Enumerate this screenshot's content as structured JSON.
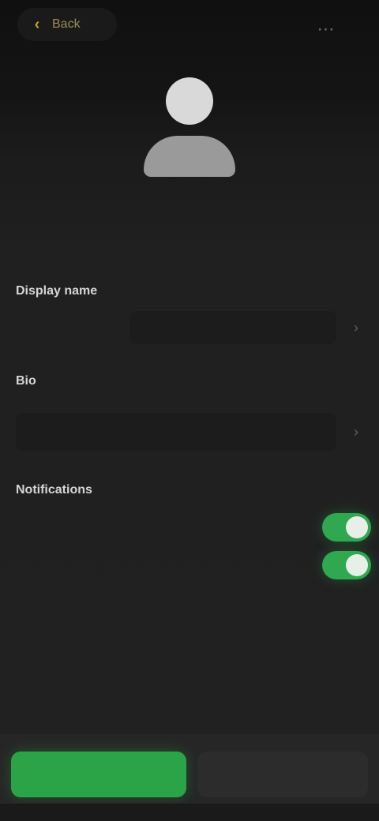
{
  "top_bar": {
    "back_label": "Back",
    "back_icon": "chevron-left-icon",
    "more_icon": "more-dots-icon"
  },
  "profile": {
    "name": "",
    "subtitle": ""
  },
  "sections": {
    "display_name": {
      "heading": "Display name",
      "field_label": "",
      "trail_icon": "chevron-right-icon"
    },
    "bio": {
      "heading": "Bio",
      "trail_icon": "chevron-right-icon"
    },
    "notifications": {
      "heading": "Notifications",
      "toggles": [
        {
          "label": "",
          "on": true
        },
        {
          "label": "",
          "on": true
        }
      ]
    }
  },
  "actions": {
    "primary_label": "",
    "secondary_label": ""
  },
  "colors": {
    "accent_gold": "#c9a227",
    "toggle_green": "#2fa84f",
    "primary_green": "#2aa447",
    "background": "#1f1f1f"
  }
}
